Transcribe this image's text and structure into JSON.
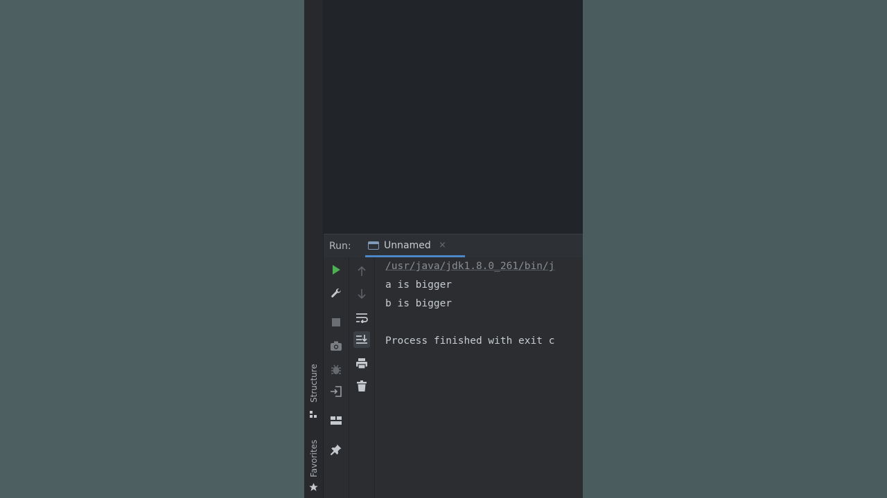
{
  "run_panel": {
    "label": "Run:",
    "tab": {
      "label": "Unnamed",
      "close": "×"
    }
  },
  "console": {
    "lines": [
      "/usr/java/jdk1.8.0_261/bin/j",
      "a is bigger",
      "b is bigger",
      "",
      "Process finished with exit c"
    ]
  },
  "side_stripe": {
    "structure": "Structure",
    "favorites": "Favorites"
  },
  "colors": {
    "run_green": "#4caf50",
    "accent_blue": "#4a88c7"
  }
}
